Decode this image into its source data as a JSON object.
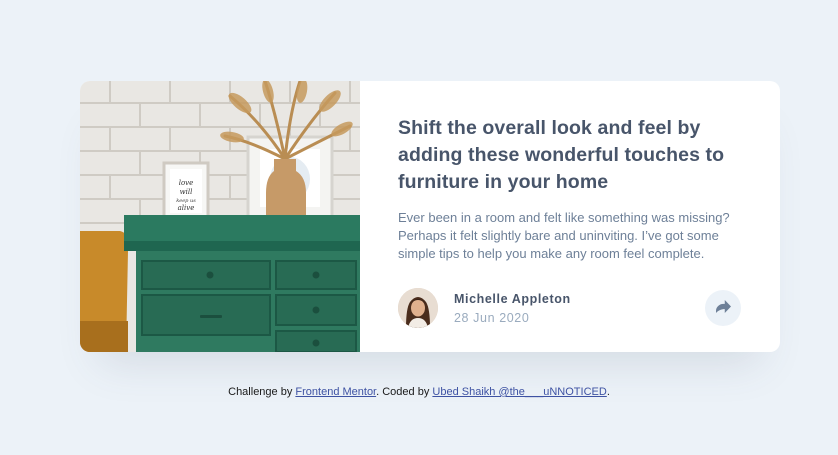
{
  "card": {
    "title": "Shift the overall look and feel by adding these wonderful touches to furniture in your home",
    "description": "Ever been in a room and felt like something was missing? Perhaps it felt slightly bare and uninviting. I’ve got some simple tips to help you make any room feel complete.",
    "image": {
      "frame_text": "love will keep us alive"
    },
    "author": {
      "name": "Michelle Appleton",
      "date": "28 Jun 2020"
    },
    "share_icon": "share-icon"
  },
  "attribution": {
    "prefix": "Challenge by",
    "link1": "Frontend Mentor",
    "middle": ". Coded by",
    "link2": "Ubed Shaikh @the___uNNOTICED",
    "suffix": "."
  },
  "colors": {
    "background": "#ecf2f8",
    "title": "#48556a",
    "body_text": "#6e8098",
    "muted": "#9aabbe",
    "link": "#3e52a3",
    "drawer": "#2f7a60"
  }
}
